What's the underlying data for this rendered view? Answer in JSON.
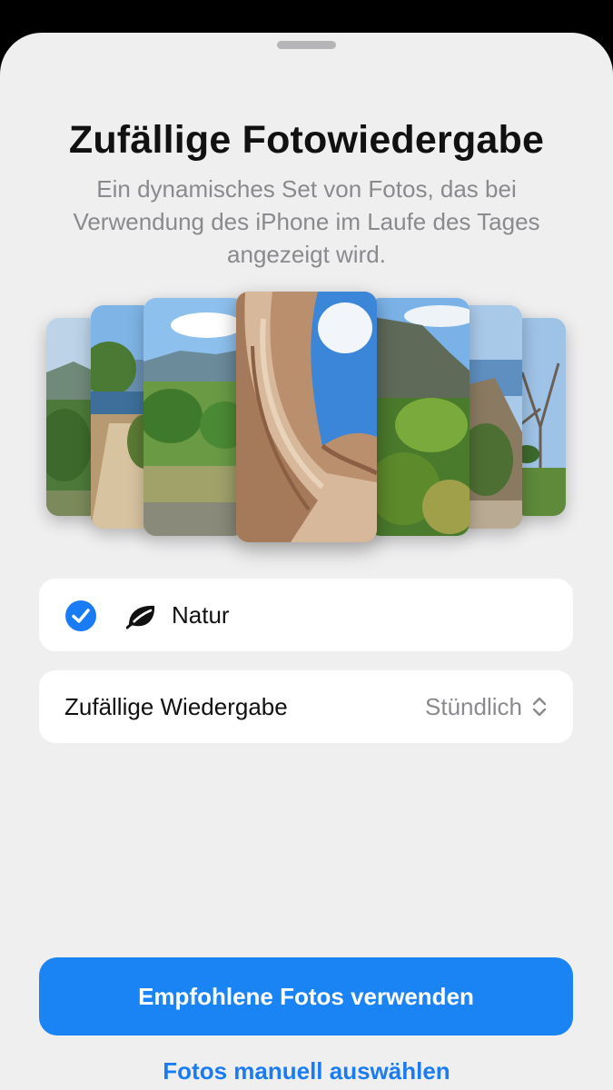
{
  "sheet": {
    "title": "Zufällige Fotowiedergabe",
    "subtitle": "Ein dynamisches Set von Fotos, das bei Verwendung des iPhone im Laufe des Tages angezeigt wird."
  },
  "carousel": {
    "photos": [
      "nature-photo-1",
      "nature-photo-2",
      "nature-photo-3",
      "nature-photo-4",
      "nature-photo-5",
      "nature-photo-6",
      "nature-photo-7"
    ],
    "selected_index": 3
  },
  "topic_row": {
    "icon": "leaf-icon",
    "label": "Natur",
    "checked": true
  },
  "shuffle_row": {
    "label": "Zufällige Wiedergabe",
    "value": "Stündlich",
    "icon": "chevron-up-down-icon"
  },
  "actions": {
    "primary_label": "Empfohlene Fotos verwenden",
    "secondary_label": "Fotos manuell auswählen"
  },
  "colors": {
    "accent": "#1a7cf5",
    "button": "#1a84f5",
    "background": "#efeff0"
  }
}
